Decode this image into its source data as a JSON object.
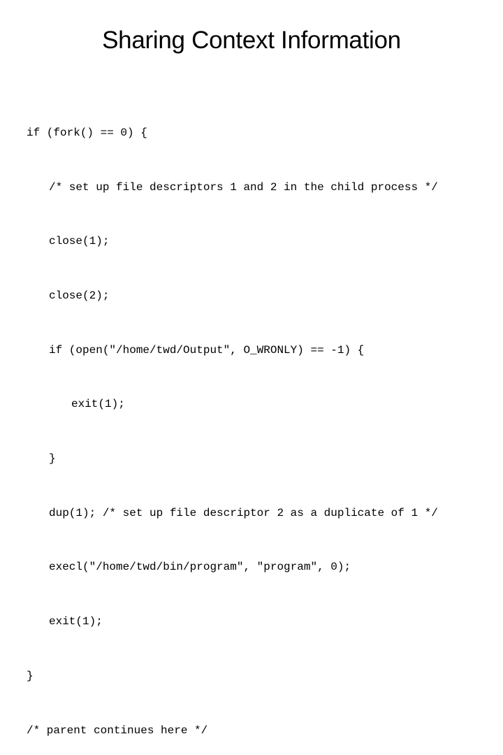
{
  "slide": {
    "title": "Sharing Context Information",
    "code_lines": [
      {
        "indent": 0,
        "text": "if (fork() == 0) {"
      },
      {
        "indent": 1,
        "text": "/* set up file descriptors 1 and 2 in the child process */"
      },
      {
        "indent": 1,
        "text": "close(1);"
      },
      {
        "indent": 1,
        "text": "close(2);"
      },
      {
        "indent": 1,
        "text": "if (open(\"/home/twd/Output\", O_WRONLY) == -1) {"
      },
      {
        "indent": 2,
        "text": "exit(1);"
      },
      {
        "indent": 1,
        "text": "}"
      },
      {
        "indent": 1,
        "text": "dup(1); /* set up file descriptor 2 as a duplicate of 1 */"
      },
      {
        "indent": 1,
        "text": "execl(\"/home/twd/bin/program\", \"program\", 0);"
      },
      {
        "indent": 1,
        "text": "exit(1);"
      },
      {
        "indent": 0,
        "text": "}"
      },
      {
        "indent": 0,
        "text": "/* parent continues here */"
      }
    ]
  }
}
